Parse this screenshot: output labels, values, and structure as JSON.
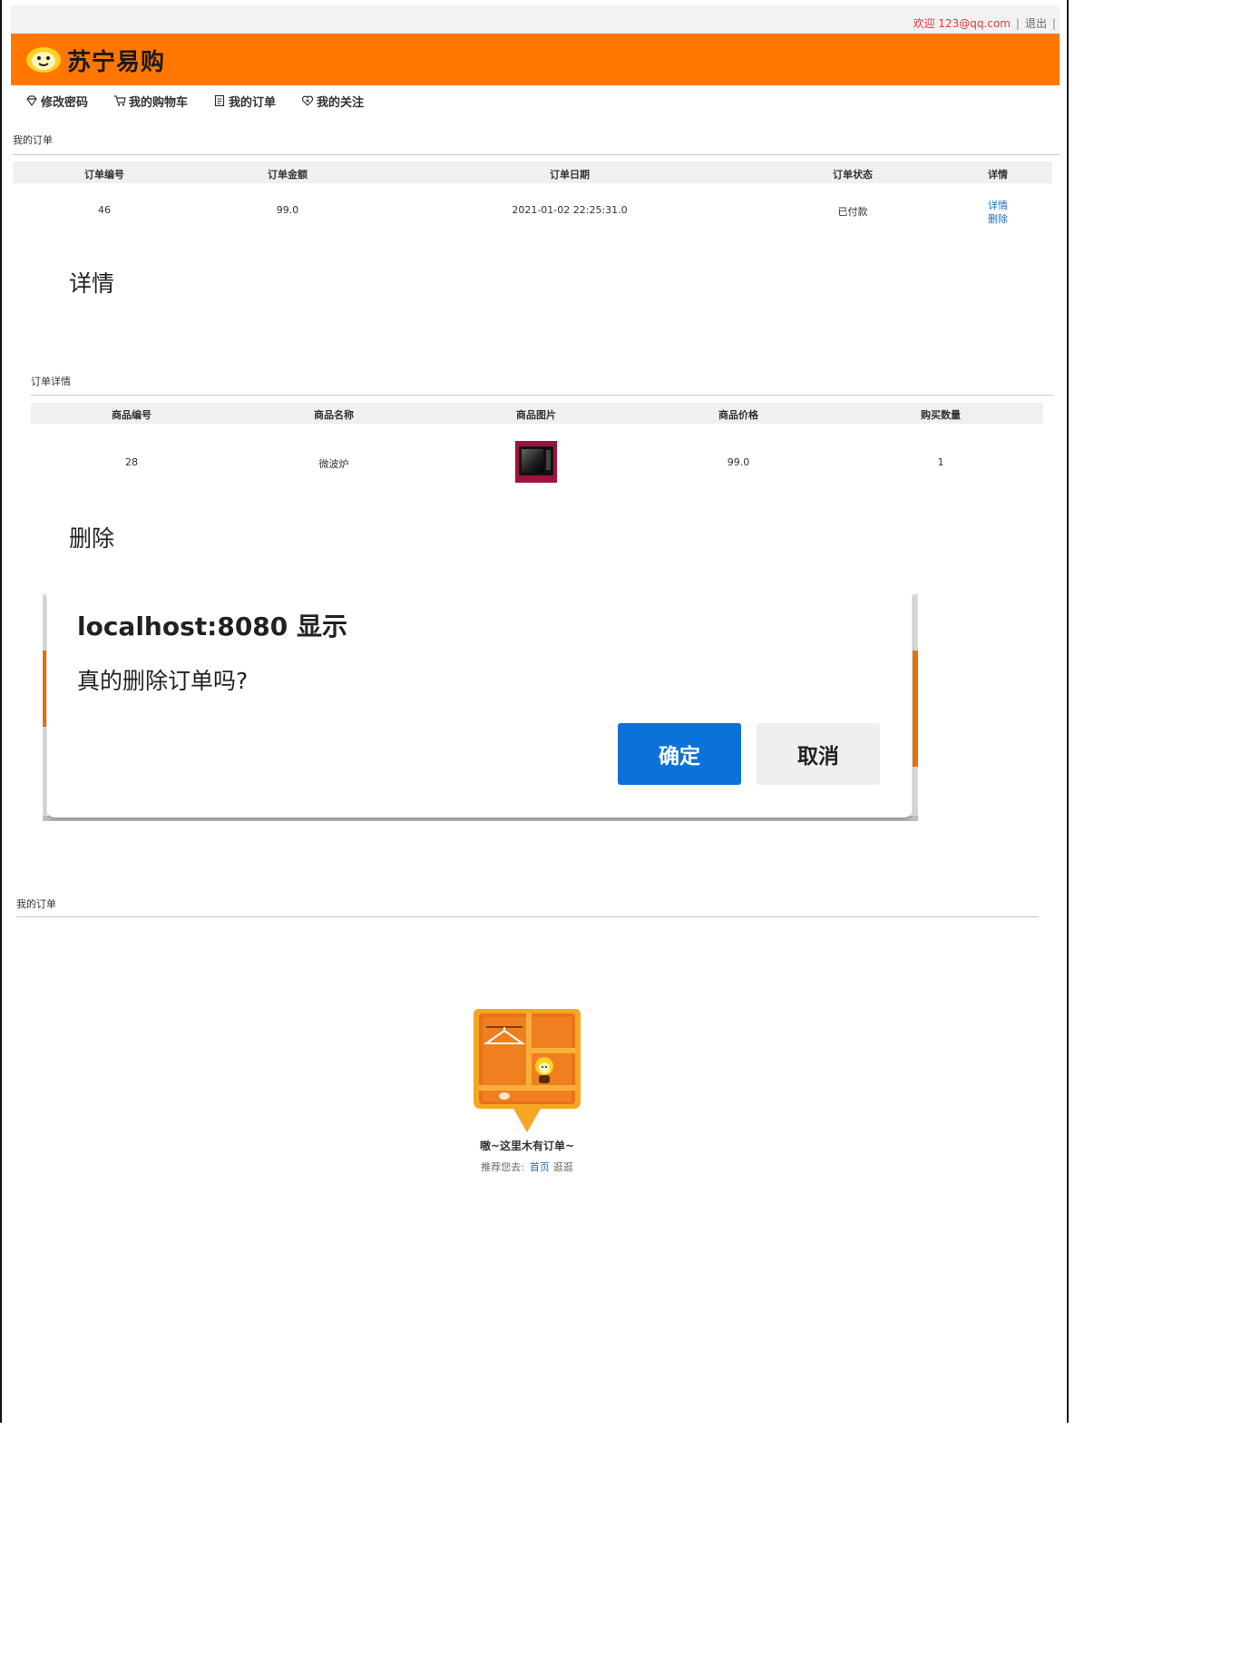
{
  "topbar": {
    "welcome": "欢迎 123@qq.com",
    "sep1": "|",
    "logout": "退出",
    "sep2": "|"
  },
  "header": {
    "logo_text": "苏宁易购",
    "brand_color": "#ff7700"
  },
  "nav": {
    "items": [
      {
        "label": "修改密码",
        "icon": "gem-icon"
      },
      {
        "label": "我的购物车",
        "icon": "cart-icon"
      },
      {
        "label": "我的订单",
        "icon": "document-icon"
      },
      {
        "label": "我的关注",
        "icon": "heart-icon"
      }
    ]
  },
  "orders": {
    "title": "我的订单",
    "headers": [
      "订单编号",
      "订单金额",
      "订单日期",
      "订单状态",
      "详情"
    ],
    "rows": [
      {
        "id": "46",
        "amount": "99.0",
        "date": "2021-01-02 22:25:31.0",
        "status": "已付款",
        "detail_link": "详情",
        "delete_link": "删除"
      }
    ]
  },
  "label_detail": "详情",
  "order_detail": {
    "title": "订单详情",
    "headers": [
      "商品编号",
      "商品名称",
      "商品图片",
      "商品价格",
      "购买数量"
    ],
    "rows": [
      {
        "product_id": "28",
        "name": "微波炉",
        "price": "99.0",
        "quantity": "1"
      }
    ]
  },
  "label_delete": "删除",
  "dialog": {
    "title": "localhost:8080 显示",
    "message": "真的删除订单吗?",
    "ok_label": "确定",
    "cancel_label": "取消",
    "ok_color": "#0b72d9"
  },
  "orders_empty": {
    "title": "我的订单",
    "empty_text": "嗷~这里木有订单~",
    "suggest_prefix": "推荐您去:",
    "home_link": "首页",
    "browse": "逛逛"
  }
}
